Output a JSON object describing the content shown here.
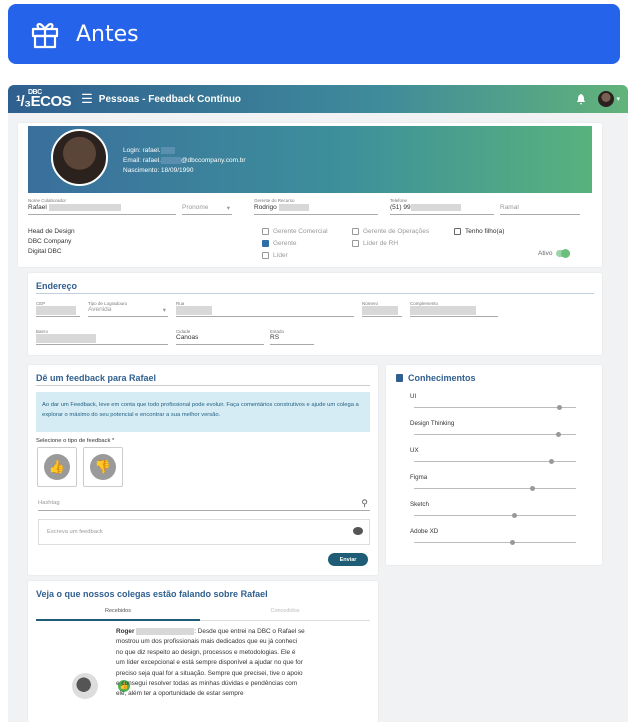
{
  "banner": {
    "title": "Antes"
  },
  "topbar": {
    "logo_small": "DBC",
    "logo_main": "ECOS",
    "logo_prefix": "¹/₃",
    "breadcrumb": "Pessoas - Feedback Contínuo"
  },
  "profile": {
    "login": "Login: rafael.",
    "email": "Email: rafael.",
    "email_domain": "@dbccompany.com.br",
    "birth": "Nascimento: 18/09/1990",
    "name_label": "Nome Colaborador",
    "name_value": "Rafael",
    "pronoun_placeholder": "Pronome",
    "manager_label": "Gerente do Recurso",
    "manager_value": "Rodrigo",
    "phone_label": "Telefone",
    "phone_value": "(51) 99",
    "ramal_placeholder": "Ramal",
    "role_lines": [
      "Head de Design",
      "DBC Company",
      "Digital DBC"
    ],
    "checks": [
      {
        "label": "Gerente Comercial",
        "checked": false
      },
      {
        "label": "Gerente de Operações",
        "checked": false
      },
      {
        "label": "Tenho filho(a)",
        "checked": false
      },
      {
        "label": "Gerente",
        "checked": true
      },
      {
        "label": "Líder de RH",
        "checked": false
      },
      {
        "label": "Líder",
        "checked": false
      }
    ],
    "active_label": "Ativo"
  },
  "address": {
    "title": "Endereço",
    "labels": {
      "cep": "CEP",
      "tipo": "Tipo de Logradouro",
      "rua": "Rua",
      "numero": "Número",
      "complemento": "Complemento",
      "bairro": "Bairro",
      "cidade": "Cidade",
      "estado": "Estado"
    },
    "values": {
      "tipo": "Avenida",
      "numero": "---",
      "complemento": "",
      "cidade": "Canoas",
      "estado": "RS"
    }
  },
  "feedback": {
    "title": "Dê um feedback para Rafael",
    "info": "Ao dar um Feedback, leve em conta que todo profissional pode evoluir. Faça comentários construtivos e ajude um colega a explorar o máximo do seu potencial e encontrar a sua melhor versão.",
    "type_label": "Selecione o tipo de feedback *",
    "hashtag_placeholder": "Hashtag",
    "text_placeholder": "Escreva um feedback",
    "send_label": "Enviar"
  },
  "knowledge": {
    "title": "Conhecimentos",
    "skills": [
      {
        "name": "UI",
        "level": 0.9
      },
      {
        "name": "Design Thinking",
        "level": 0.89
      },
      {
        "name": "UX",
        "level": 0.85
      },
      {
        "name": "Figma",
        "level": 0.73
      },
      {
        "name": "Sketch",
        "level": 0.62
      },
      {
        "name": "Adobe XD",
        "level": 0.61
      }
    ]
  },
  "colleagues": {
    "title": "Veja o que nossos colegas estão falando sobre Rafael",
    "tabs": [
      "Recebidos",
      "Concedidos"
    ],
    "comment_author": "Roger",
    "comment_text": ": Desde que entrei na DBC o Rafael se mostrou um dos profissionais mais dedicados que eu já conheci no que diz respeito ao design, processos e metodologias. Ele é um líder excepcional e está sempre disponível a ajudar no que for preciso seja qual for a situação. Sempre que precisei, tive o apoio e consegui resolver todas as minhas dúvidas e pendências com ele, além ter a oportunidade de estar sempre"
  }
}
